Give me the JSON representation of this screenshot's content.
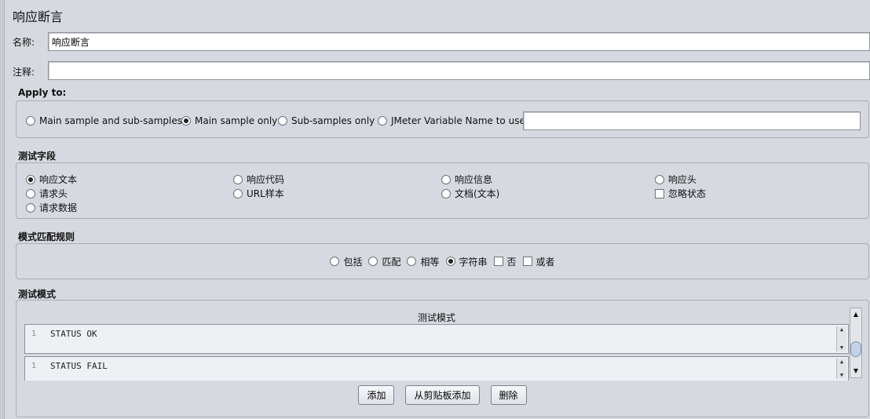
{
  "panel": {
    "title": "响应断言"
  },
  "name_field": {
    "label": "名称:",
    "value": "响应断言"
  },
  "comment_field": {
    "label": "注释:",
    "value": ""
  },
  "apply_to": {
    "title": "Apply to:",
    "options": [
      {
        "label": "Main sample and sub-samples",
        "selected": false
      },
      {
        "label": "Main sample only",
        "selected": true
      },
      {
        "label": "Sub-samples only",
        "selected": false
      },
      {
        "label": "JMeter Variable Name to use",
        "selected": false
      }
    ],
    "variable_value": ""
  },
  "test_field": {
    "title": "测试字段",
    "options": [
      {
        "label": "响应文本",
        "type": "radio",
        "selected": true
      },
      {
        "label": "响应代码",
        "type": "radio",
        "selected": false
      },
      {
        "label": "响应信息",
        "type": "radio",
        "selected": false
      },
      {
        "label": "响应头",
        "type": "radio",
        "selected": false
      },
      {
        "label": "请求头",
        "type": "radio",
        "selected": false
      },
      {
        "label": "URL样本",
        "type": "radio",
        "selected": false
      },
      {
        "label": "文档(文本)",
        "type": "radio",
        "selected": false
      },
      {
        "label": "忽略状态",
        "type": "checkbox",
        "selected": false
      },
      {
        "label": "请求数据",
        "type": "radio",
        "selected": false
      }
    ]
  },
  "match_rule": {
    "title": "模式匹配规则",
    "options": [
      {
        "label": "包括",
        "type": "radio",
        "selected": false
      },
      {
        "label": "匹配",
        "type": "radio",
        "selected": false
      },
      {
        "label": "相等",
        "type": "radio",
        "selected": false
      },
      {
        "label": "字符串",
        "type": "radio",
        "selected": true
      },
      {
        "label": "否",
        "type": "checkbox",
        "selected": false
      },
      {
        "label": "或者",
        "type": "checkbox",
        "selected": false
      }
    ]
  },
  "patterns": {
    "title": "测试模式",
    "column_header": "测试模式",
    "rows": [
      {
        "line": "1",
        "text": "STATUS OK"
      },
      {
        "line": "1",
        "text": "STATUS FAIL"
      }
    ],
    "buttons": {
      "add": "添加",
      "add_clipboard": "从剪贴板添加",
      "delete": "删除"
    }
  }
}
